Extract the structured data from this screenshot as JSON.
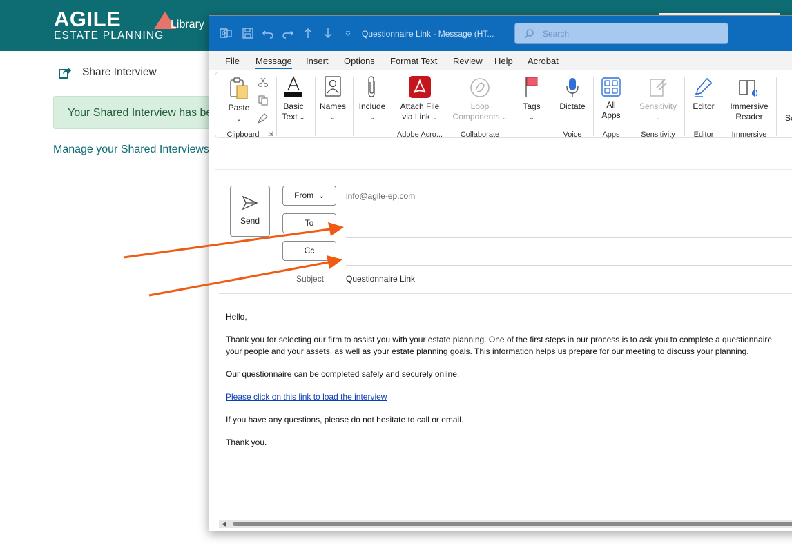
{
  "app": {
    "logo_main": "AGILE",
    "logo_sub": "ESTATE PLANNING",
    "nav_library": "Library",
    "share_title": "Share Interview",
    "alert_text": "Your Shared Interview has be",
    "manage_link": "Manage your Shared Interviews",
    "colors": {
      "header": "#0e6c73",
      "alert_bg": "#d8eedf",
      "logo_accent": "#e8736a"
    }
  },
  "outlook": {
    "title": "Questionnaire Link  -  Message (HT...",
    "search_placeholder": "Search",
    "menu": [
      "File",
      "Message",
      "Insert",
      "Options",
      "Format Text",
      "Review",
      "Help",
      "Acrobat"
    ],
    "active_menu": "Message",
    "ribbon": {
      "paste": "Paste",
      "basic_text_1": "Basic",
      "basic_text_2": "Text",
      "names": "Names",
      "include": "Include",
      "attach_1": "Attach File",
      "attach_2": "via Link",
      "loop_1": "Loop",
      "loop_2": "Components",
      "tags": "Tags",
      "dictate": "Dictate",
      "all_apps_1": "All",
      "all_apps_2": "Apps",
      "sensitivity": "Sensitivity",
      "editor": "Editor",
      "immersive_1": "Immersive",
      "immersive_2": "Reader",
      "cut_off": "Sc",
      "groups": {
        "clipboard": "Clipboard",
        "adobe": "Adobe Acro...",
        "collaborate": "Collaborate",
        "voice": "Voice",
        "apps": "Apps",
        "sensitivity": "Sensitivity",
        "editor": "Editor",
        "immersive": "Immersive"
      }
    },
    "send": "Send",
    "from_label": "From",
    "from_value": "info@agile-ep.com",
    "to_label": "To",
    "cc_label": "Cc",
    "subject_label": "Subject",
    "subject_value": "Questionnaire Link",
    "body": {
      "greeting": "Hello,",
      "p1_line1": "Thank you for selecting our firm to assist you with your estate planning. One of the first steps in our process is to ask you to complete a questionnaire",
      "p1_line2": "your people and your assets, as well as your estate planning goals. This information helps us prepare for our meeting to discuss your planning.",
      "p2": "Our questionnaire can be completed safely and securely online.",
      "link": "Please click on this link to load the interview",
      "p3": "If you have any questions, please do not hesitate to call or email.",
      "closing": "Thank you."
    },
    "colors": {
      "title_bar": "#0f6cbd",
      "annotation_arrow": "#f05a12",
      "link": "#0b3fb8"
    }
  }
}
